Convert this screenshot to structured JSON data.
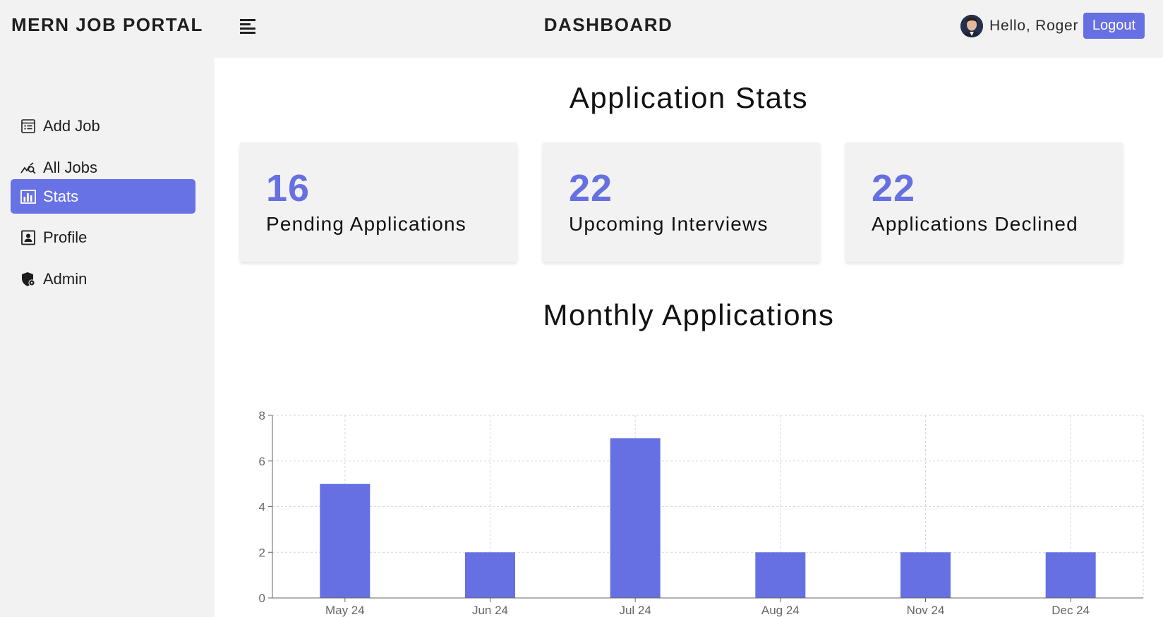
{
  "header": {
    "logo": "MERN JOB PORTAL",
    "title": "DASHBOARD",
    "greeting": "Hello, Roger",
    "logout_label": "Logout"
  },
  "sidebar": {
    "items": [
      {
        "label": "Add Job",
        "icon": "add-job-icon",
        "active": false
      },
      {
        "label": "All Jobs",
        "icon": "all-jobs-icon",
        "active": false
      },
      {
        "label": "Stats",
        "icon": "bar-chart-icon",
        "active": true
      },
      {
        "label": "Profile",
        "icon": "profile-icon",
        "active": false
      },
      {
        "label": "Admin",
        "icon": "admin-shield-icon",
        "active": false
      }
    ]
  },
  "main": {
    "stats_title": "Application Stats",
    "stats": [
      {
        "value": "16",
        "label": "Pending Applications"
      },
      {
        "value": "22",
        "label": "Upcoming Interviews"
      },
      {
        "value": "22",
        "label": "Applications Declined"
      }
    ],
    "chart_title": "Monthly Applications"
  },
  "colors": {
    "accent": "#6670e3",
    "background": "#f2f2f2",
    "content": "#ffffff"
  },
  "chart_data": {
    "type": "bar",
    "title": "Monthly Applications",
    "categories": [
      "May 24",
      "Jun 24",
      "Jul 24",
      "Aug 24",
      "Nov 24",
      "Dec 24"
    ],
    "values": [
      5,
      2,
      7,
      2,
      2,
      2
    ],
    "ylim": [
      0,
      8
    ],
    "yticks": [
      0,
      2,
      4,
      6,
      8
    ],
    "grid": true,
    "bar_color": "#6670e3"
  }
}
